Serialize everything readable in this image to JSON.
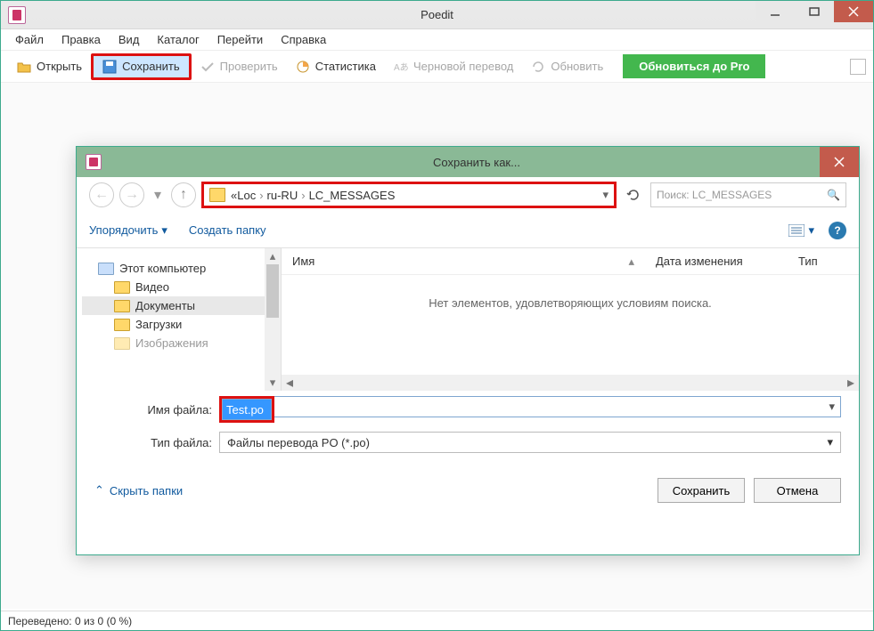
{
  "app": {
    "title": "Poedit"
  },
  "menu": {
    "file": "Файл",
    "edit": "Правка",
    "view": "Вид",
    "catalog": "Каталог",
    "go": "Перейти",
    "help": "Справка"
  },
  "toolbar": {
    "open": "Открыть",
    "save": "Сохранить",
    "check": "Проверить",
    "stats": "Статистика",
    "draft": "Черновой перевод",
    "update": "Обновить",
    "pro": "Обновиться до Pro"
  },
  "dialog": {
    "title": "Сохранить как...",
    "breadcrumb": {
      "prefix": "«",
      "p1": "Loc",
      "p2": "ru-RU",
      "p3": "LC_MESSAGES"
    },
    "search_placeholder": "Поиск: LC_MESSAGES",
    "organize": "Упорядочить",
    "newFolder": "Создать папку",
    "tree": [
      {
        "label": "Этот компьютер",
        "type": "pc"
      },
      {
        "label": "Видео",
        "type": "f"
      },
      {
        "label": "Документы",
        "type": "f",
        "sel": true
      },
      {
        "label": "Загрузки",
        "type": "f"
      },
      {
        "label": "Изображения",
        "type": "f"
      }
    ],
    "columns": {
      "name": "Имя",
      "date": "Дата изменения",
      "type": "Тип"
    },
    "empty": "Нет элементов, удовлетворяющих условиям поиска.",
    "fileNameLabel": "Имя файла:",
    "fileName": "Test.po",
    "fileTypeLabel": "Тип файла:",
    "fileType": "Файлы перевода PO (*.po)",
    "hideFolders": "Скрыть папки",
    "save": "Сохранить",
    "cancel": "Отмена"
  },
  "status": {
    "text": "Переведено: 0 из 0 (0 %)"
  }
}
